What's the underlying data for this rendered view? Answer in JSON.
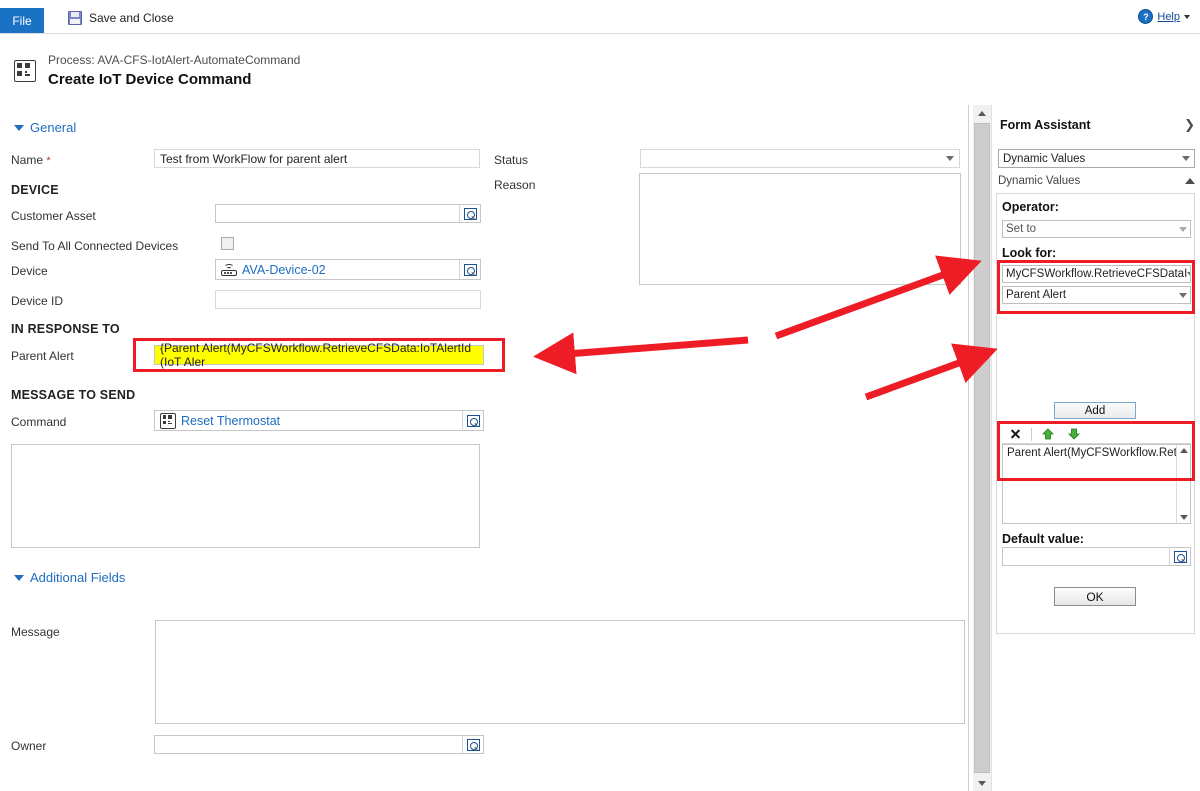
{
  "ribbon": {
    "file_tab": "File",
    "save_and_close": "Save and Close",
    "help": "Help"
  },
  "header": {
    "process_label": "Process: AVA-CFS-IotAlert-AutomateCommand",
    "title": "Create IoT Device Command"
  },
  "form": {
    "general_section": "General",
    "additional_section": "Additional Fields",
    "subheads": {
      "device": "DEVICE",
      "in_response_to": "IN RESPONSE TO",
      "message_to_send": "MESSAGE TO SEND"
    },
    "fields": {
      "name_label": "Name",
      "name_required": "*",
      "name_value": "Test from WorkFlow for parent alert",
      "status_label": "Status",
      "status_value": "",
      "reason_label": "Reason",
      "reason_value": "",
      "customer_asset_label": "Customer Asset",
      "customer_asset_value": "",
      "send_all_label": "Send To All Connected Devices",
      "device_label": "Device",
      "device_value": "AVA-Device-02",
      "device_id_label": "Device ID",
      "device_id_value": "",
      "parent_alert_label": "Parent Alert",
      "parent_alert_value": "{Parent Alert(MyCFSWorkflow.RetrieveCFSData:IoTAlertId (IoT Aler",
      "command_label": "Command",
      "command_value": "Reset Thermostat",
      "message_label": "Message",
      "message_value": "",
      "owner_label": "Owner",
      "owner_value": ""
    }
  },
  "form_assistant": {
    "title": "Form Assistant",
    "expand_icon": "chevron-right",
    "type_select": "Dynamic Values",
    "group_header": "Dynamic Values",
    "operator_label": "Operator:",
    "operator_value": "Set to",
    "look_for_label": "Look for:",
    "look_for_entity": "MyCFSWorkflow.RetrieveCFSDataI",
    "look_for_field": "Parent Alert",
    "add_button": "Add",
    "toolbar": {
      "delete": "delete-icon",
      "move_up": "move-up-icon",
      "move_down": "move-down-icon"
    },
    "list_items": [
      "Parent Alert(MyCFSWorkflow.Retrie"
    ],
    "default_value_label": "Default value:",
    "default_value": "",
    "ok_button": "OK"
  },
  "colors": {
    "accent_blue": "#1a72c4",
    "link_blue": "#1f6dc0",
    "annotation_red": "#ee1c25",
    "highlight_yellow": "#ffff00"
  }
}
